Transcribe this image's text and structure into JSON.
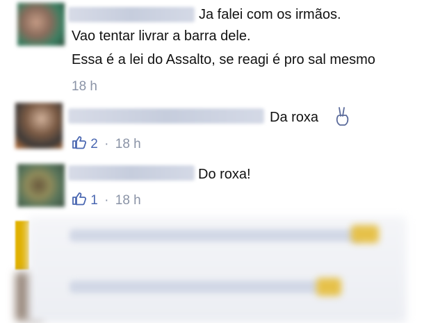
{
  "comments": [
    {
      "author": "",
      "lines": [
        "Ja falei com os irmãos.",
        "Vao tentar livrar a barra dele.",
        "Essa é a lei do Assalto, se reagi é pro sal mesmo"
      ],
      "time": "18 h"
    },
    {
      "author": "",
      "text": "Da roxa",
      "likes": "2",
      "sep": "·",
      "time": "18 h"
    },
    {
      "author": "",
      "text": "Do roxa!",
      "likes": "1",
      "sep": "·",
      "time": "18 h"
    }
  ],
  "colors": {
    "like_blue": "#4a67b1",
    "meta_gray": "#8a93a6",
    "blur_bg": "#d7dbe7"
  },
  "icons": [
    "like-thumb-icon",
    "peace-hand-icon"
  ]
}
